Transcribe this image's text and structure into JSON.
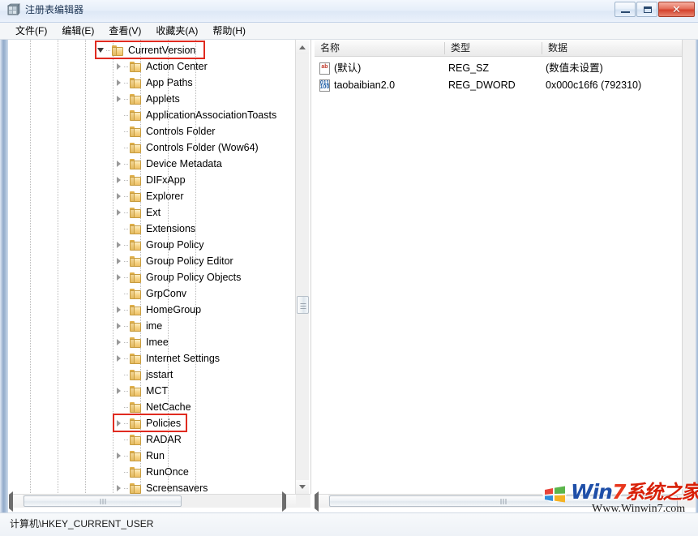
{
  "window": {
    "title": "注册表编辑器",
    "icon": "regedit-icon",
    "controls": {
      "minimize_label": "—",
      "maximize_label": "□",
      "close_label": "✕"
    }
  },
  "menubar": {
    "items": [
      {
        "label": "文件(F)"
      },
      {
        "label": "编辑(E)"
      },
      {
        "label": "查看(V)"
      },
      {
        "label": "收藏夹(A)"
      },
      {
        "label": "帮助(H)"
      }
    ]
  },
  "tree": {
    "items": [
      {
        "label": "CurrentVersion",
        "depth": 0,
        "expander": "expanded",
        "highlight": true
      },
      {
        "label": "Action Center",
        "depth": 1,
        "expander": "collapsed",
        "highlight": false
      },
      {
        "label": "App Paths",
        "depth": 1,
        "expander": "collapsed",
        "highlight": false
      },
      {
        "label": "Applets",
        "depth": 1,
        "expander": "collapsed",
        "highlight": false
      },
      {
        "label": "ApplicationAssociationToasts",
        "depth": 1,
        "expander": "none",
        "highlight": false
      },
      {
        "label": "Controls Folder",
        "depth": 1,
        "expander": "none",
        "highlight": false
      },
      {
        "label": "Controls Folder (Wow64)",
        "depth": 1,
        "expander": "none",
        "highlight": false
      },
      {
        "label": "Device Metadata",
        "depth": 1,
        "expander": "collapsed",
        "highlight": false
      },
      {
        "label": "DIFxApp",
        "depth": 1,
        "expander": "collapsed",
        "highlight": false
      },
      {
        "label": "Explorer",
        "depth": 1,
        "expander": "collapsed",
        "highlight": false
      },
      {
        "label": "Ext",
        "depth": 1,
        "expander": "collapsed",
        "highlight": false
      },
      {
        "label": "Extensions",
        "depth": 1,
        "expander": "none",
        "highlight": false
      },
      {
        "label": "Group Policy",
        "depth": 1,
        "expander": "collapsed",
        "highlight": false
      },
      {
        "label": "Group Policy Editor",
        "depth": 1,
        "expander": "collapsed",
        "highlight": false
      },
      {
        "label": "Group Policy Objects",
        "depth": 1,
        "expander": "collapsed",
        "highlight": false
      },
      {
        "label": "GrpConv",
        "depth": 1,
        "expander": "none",
        "highlight": false
      },
      {
        "label": "HomeGroup",
        "depth": 1,
        "expander": "collapsed",
        "highlight": false
      },
      {
        "label": "ime",
        "depth": 1,
        "expander": "collapsed",
        "highlight": false
      },
      {
        "label": "Imee",
        "depth": 1,
        "expander": "collapsed",
        "highlight": false
      },
      {
        "label": "Internet Settings",
        "depth": 1,
        "expander": "collapsed",
        "highlight": false
      },
      {
        "label": "jsstart",
        "depth": 1,
        "expander": "none",
        "highlight": false
      },
      {
        "label": "MCT",
        "depth": 1,
        "expander": "collapsed",
        "highlight": false
      },
      {
        "label": "NetCache",
        "depth": 1,
        "expander": "none",
        "highlight": false
      },
      {
        "label": "Policies",
        "depth": 1,
        "expander": "collapsed",
        "highlight": true
      },
      {
        "label": "RADAR",
        "depth": 1,
        "expander": "none",
        "highlight": false
      },
      {
        "label": "Run",
        "depth": 1,
        "expander": "collapsed",
        "highlight": false
      },
      {
        "label": "RunOnce",
        "depth": 1,
        "expander": "none",
        "highlight": false
      },
      {
        "label": "Screensavers",
        "depth": 1,
        "expander": "collapsed",
        "highlight": false
      }
    ],
    "highlight_color": "#e02b20"
  },
  "values": {
    "columns": [
      {
        "label": "名称"
      },
      {
        "label": "类型"
      },
      {
        "label": "数据"
      }
    ],
    "rows": [
      {
        "name": "(默认)",
        "type": "REG_SZ",
        "data": "(数值未设置)",
        "icon": "string-value-icon"
      },
      {
        "name": "taobaibian2.0",
        "type": "REG_DWORD",
        "data": "0x000c16f6 (792310)",
        "icon": "dword-value-icon"
      }
    ]
  },
  "statusbar": {
    "path": "计算机\\HKEY_CURRENT_USER"
  },
  "watermark": {
    "brand_win": "Win",
    "brand_seven": "7",
    "brand_cn": "系统之家",
    "url": "Www.Winwin7.com"
  }
}
